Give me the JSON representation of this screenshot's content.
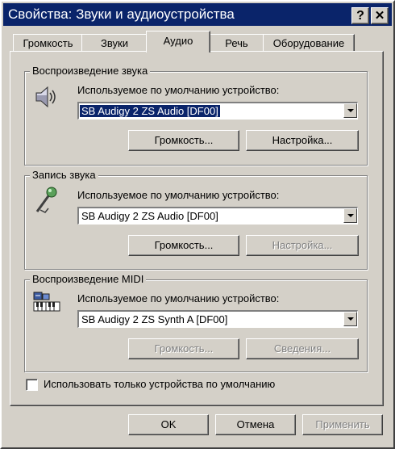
{
  "window": {
    "title": "Свойства: Звуки и аудиоустройства",
    "help_label": "?",
    "close_label": "✕"
  },
  "tabs": [
    {
      "label": "Громкость",
      "active": false
    },
    {
      "label": "Звуки",
      "active": false
    },
    {
      "label": "Аудио",
      "active": true
    },
    {
      "label": "Речь",
      "active": false
    },
    {
      "label": "Оборудование",
      "active": false
    }
  ],
  "playback": {
    "group_label": "Воспроизведение звука",
    "icon": "speaker-icon",
    "device_label": "Используемое по умолчанию устройство:",
    "device_value": "SB Audigy 2 ZS Audio [DF00]",
    "volume_button": "Громкость...",
    "settings_button": "Настройка..."
  },
  "recording": {
    "group_label": "Запись звука",
    "icon": "microphone-icon",
    "device_label": "Используемое по умолчанию устройство:",
    "device_value": "SB Audigy 2 ZS Audio [DF00]",
    "volume_button": "Громкость...",
    "settings_button": "Настройка..."
  },
  "midi": {
    "group_label": "Воспроизведение MIDI",
    "icon": "midi-keyboard-icon",
    "device_label": "Используемое по умолчанию устройство:",
    "device_value": "SB Audigy 2 ZS Synth A [DF00]",
    "volume_button": "Громкость...",
    "about_button": "Сведения..."
  },
  "default_only_checkbox": {
    "label": "Использовать только устройства по умолчанию",
    "checked": false
  },
  "footer": {
    "ok": "OK",
    "cancel": "Отмена",
    "apply": "Применить"
  },
  "colors": {
    "titlebar": "#0a246a",
    "face": "#d4d0c8",
    "selection": "#0a246a"
  }
}
